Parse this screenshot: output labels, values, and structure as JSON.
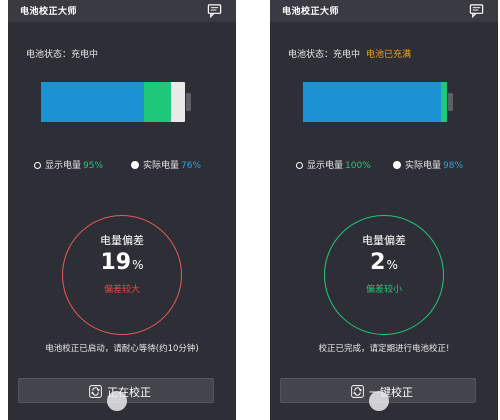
{
  "colors": {
    "blue": "#1b93d2",
    "green": "#1fc87a",
    "orange": "#f0a21b",
    "red": "#e84545",
    "background": "#2e2f36"
  },
  "screens": [
    {
      "app_title": "电池校正大师",
      "battery_status_label": "电池状态：充电中",
      "battery_status_extra": "",
      "battery_shown_level": 0.95,
      "battery_actual_level": 0.76,
      "legend_shown_label": "显示电量",
      "legend_shown_value": "95%",
      "legend_actual_label": "实际电量",
      "legend_actual_value": "76%",
      "gauge_title": "电量偏差",
      "gauge_value": "19",
      "gauge_unit": "%",
      "gauge_note": "偏差较大",
      "info_text": "电池校正已启动，请耐心等待(约10分钟)",
      "button_label": "正在校正",
      "icons": [
        "message-icon",
        "sync-icon"
      ]
    },
    {
      "app_title": "电池校正大师",
      "battery_status_label": "电池状态：充电中",
      "battery_status_extra": "电池已充满",
      "battery_shown_level": 1.0,
      "battery_actual_level": 0.98,
      "legend_shown_label": "显示电量",
      "legend_shown_value": "100%",
      "legend_actual_label": "实际电量",
      "legend_actual_value": "98%",
      "gauge_title": "电量偏差",
      "gauge_value": "2",
      "gauge_unit": "%",
      "gauge_note": "偏差较小",
      "info_text": "校正已完成，请定期进行电池校正!",
      "button_label": "一键校正",
      "icons": [
        "message-icon",
        "sync-icon"
      ]
    }
  ]
}
